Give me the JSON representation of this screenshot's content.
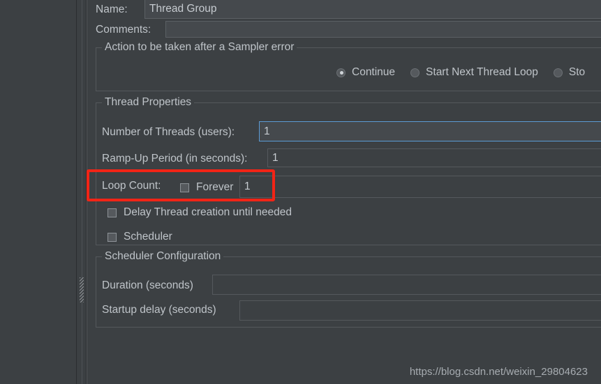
{
  "window": {
    "background_color": "#3c4043",
    "panel_border_color": "#54585c"
  },
  "form": {
    "name": {
      "label": "Name:",
      "value": "Thread Group"
    },
    "comments": {
      "label": "Comments:",
      "value": ""
    },
    "action_group": {
      "title": "Action to be taken after a Sampler error",
      "options": [
        {
          "label": "Continue",
          "selected": true
        },
        {
          "label": "Start Next Thread Loop",
          "selected": false
        },
        {
          "label": "Sto",
          "selected": false
        }
      ]
    },
    "thread_properties": {
      "title": "Thread Properties",
      "number_of_threads": {
        "label": "Number of Threads (users):",
        "value": "1",
        "focused": true
      },
      "ramp_up_period": {
        "label": "Ramp-Up Period (in seconds):",
        "value": "1"
      },
      "loop_count": {
        "label": "Loop Count:",
        "forever_label": "Forever",
        "forever_checked": false,
        "value": "1"
      },
      "delay_thread_creation": {
        "label": "Delay Thread creation until needed",
        "checked": false
      },
      "scheduler": {
        "label": "Scheduler",
        "checked": false
      }
    },
    "scheduler_configuration": {
      "title": "Scheduler Configuration",
      "duration": {
        "label": "Duration (seconds)",
        "value": ""
      },
      "startup_delay": {
        "label": "Startup delay (seconds)",
        "value": ""
      }
    }
  },
  "annotation": {
    "color": "#f22416",
    "target": "loop-count-row"
  },
  "watermark": {
    "text": "https://blog.csdn.net/weixin_29804623"
  }
}
